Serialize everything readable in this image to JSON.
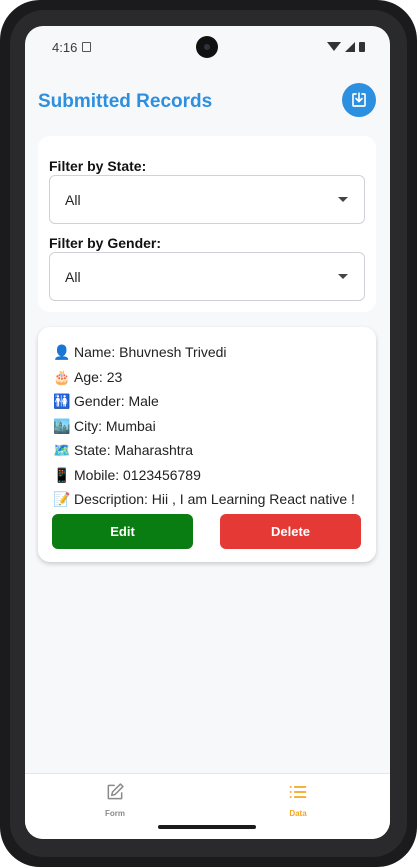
{
  "status_bar": {
    "time": "4:16"
  },
  "header": {
    "title": "Submitted Records"
  },
  "filters": {
    "state_label": "Filter by State:",
    "state_value": "All",
    "gender_label": "Filter by Gender:",
    "gender_value": "All"
  },
  "record": {
    "name": {
      "emoji": "👤",
      "text": "Name: Bhuvnesh Trivedi"
    },
    "age": {
      "emoji": "🎂",
      "text": "Age: 23"
    },
    "gender": {
      "emoji": "🚻",
      "text": "Gender: Male"
    },
    "city": {
      "emoji": "🏙️",
      "text": "City: Mumbai"
    },
    "state": {
      "emoji": "🗺️",
      "text": "State: Maharashtra"
    },
    "mobile": {
      "emoji": "📱",
      "text": "Mobile: 0123456789"
    },
    "description": {
      "emoji": "📝",
      "text": "Description: Hii , I am Learning React native !"
    },
    "edit_label": "Edit",
    "delete_label": "Delete"
  },
  "bottom_nav": {
    "form_label": "Form",
    "data_label": "Data",
    "active": "Data"
  },
  "colors": {
    "accent": "#2d8fe0",
    "edit": "#0a7d12",
    "delete": "#e53935",
    "active_tab": "#f5a623"
  },
  "icons": {
    "download": "download-icon",
    "form": "edit-form-icon",
    "data": "list-icon"
  }
}
